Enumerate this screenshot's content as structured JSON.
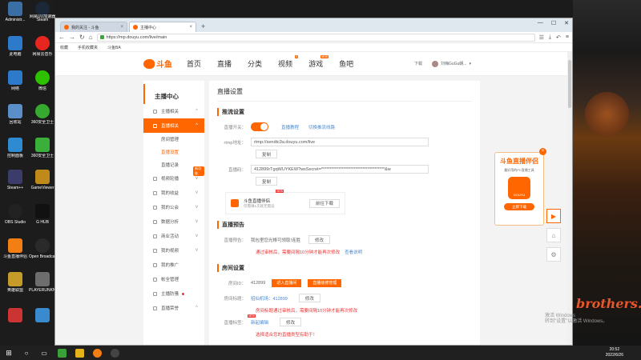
{
  "desktop": {
    "icons": [
      {
        "label": "Administr...",
        "color": "#3a6ea5"
      },
      {
        "label": "Steam",
        "color": "#1b2838"
      },
      {
        "label": "网易UU加速器",
        "color": "#2a7fd4"
      },
      {
        "label": "此电脑",
        "color": "#2c7ac9"
      },
      {
        "label": "网易云音乐",
        "color": "#e6261f"
      },
      {
        "label": "网络",
        "color": "#2c7ac9"
      },
      {
        "label": "微信",
        "color": "#2dc100"
      },
      {
        "label": "回收站",
        "color": "#5b8fc9"
      },
      {
        "label": "360安全卫士",
        "color": "#36a930"
      },
      {
        "label": "控制面板",
        "color": "#2f8bd1"
      },
      {
        "label": "360安全卫士",
        "color": "#3ab03a"
      },
      {
        "label": "Steam++",
        "color": "#3c3c6a"
      },
      {
        "label": "GameViewer",
        "color": "#c08a1a"
      },
      {
        "label": "OBS Studio",
        "color": "#222"
      },
      {
        "label": "G HUB",
        "color": "#111"
      },
      {
        "label": "斗鱼直播伴侣",
        "color": "#f27e14"
      },
      {
        "label": "Open Broadcaster",
        "color": "#2a2a2a"
      },
      {
        "label": "英雄联盟",
        "color": "#c59b2a"
      },
      {
        "label": "PLAYERUNKNOWN'S BATTLEGR...",
        "color": "#6d6d6d"
      },
      {
        "label": "",
        "color": "#c33"
      },
      {
        "label": "",
        "color": "#3a8ad0"
      }
    ]
  },
  "taskbar": {
    "time": "20:52",
    "date": "2022/6/26"
  },
  "browser": {
    "tabs": [
      {
        "label": "我的关注 - 斗鱼"
      },
      {
        "label": "主播中心"
      }
    ],
    "new_tab": "+",
    "url": "https://mp.douyu.com/live/main",
    "bookmarks": [
      "收藏",
      "手机收藏夹",
      "斗鱼BA"
    ]
  },
  "douyu": {
    "logo": "斗鱼",
    "nav": [
      {
        "label": "首页"
      },
      {
        "label": "直播"
      },
      {
        "label": "分类"
      },
      {
        "label": "视频",
        "badge": "5"
      },
      {
        "label": "游戏",
        "badge": "NEW"
      },
      {
        "label": "鱼吧"
      }
    ],
    "download": "下载",
    "username": "刘嗨GuGu朗..."
  },
  "sidebar": {
    "title": "主播中心",
    "items": [
      {
        "label": "主播相关"
      },
      {
        "label": "直播相关",
        "active": true
      },
      {
        "label": "房间管理",
        "sub": true
      },
      {
        "label": "直播设置",
        "sub": true,
        "on": true
      },
      {
        "label": "直播记录",
        "sub": true
      },
      {
        "label": "视频轮播"
      },
      {
        "label": "我的收益"
      },
      {
        "label": "我的公会"
      },
      {
        "label": "数据分析"
      },
      {
        "label": "商业活动"
      },
      {
        "label": "我的视频"
      },
      {
        "label": "我的推广"
      },
      {
        "label": "帐全管理"
      },
      {
        "label": "主播防骚",
        "dot": true
      },
      {
        "label": "直播荣誉"
      }
    ],
    "new_tag": "新功能"
  },
  "content": {
    "title": "直播设置",
    "push_section": "推流设置",
    "live_switch_label": "直播开关：",
    "live_tutorial": "直播教程",
    "backup_line": "切换推流线路",
    "rtmp_label": "rtmp地址：",
    "rtmp_value": "rtmp://sendtc3a.douyu.com/live",
    "copy1": "复制",
    "stream_label": "直播码：",
    "stream_value": "412899rTgqWUYKEW?wsSecret=*************************************&w",
    "copy2": "复制",
    "promo_title": "斗鱼直播伴侣",
    "promo_sub": "仅需填1次就无需设",
    "promo_new": "NEW",
    "promo_btn": "前往下载",
    "preview_section": "直播预告",
    "preview_label": "直播预告：",
    "preview_value": "我包里您光棒可领取!连胜",
    "preview_edit": "修改",
    "preview_warn": "通过审核后，需要间隔10分钟才能再次修改",
    "preview_rule": "查看说明",
    "room_section": "房间设置",
    "room_id_label": "房间ID：",
    "room_id": "412899",
    "enter_room": "进入直播间",
    "room_decor": "直播装修管理",
    "room_name_label": "房间标题：",
    "room_name": "招仙机场：412899",
    "room_name_edit": "修改",
    "room_name_warn": "房间标题通过审核后，需要间隔10分钟才能再次修改",
    "room_tag_label": "直播标签：",
    "room_tag_new": "NEW",
    "room_tag_value": "新起编辑",
    "room_tag_edit": "修改",
    "bottom_hint": "选择适合您的直播类型有助于！"
  },
  "float_widget": {
    "title": "斗鱼直播伴侣",
    "subtitle": "最好用的PC直播工具",
    "app_label": "DOUYU",
    "button": "立即下载",
    "close": "×"
  },
  "activation": {
    "line1": "激活 Windows",
    "line2": "转到\"设置\"以激活 Windows。"
  },
  "wall_text": "brothers."
}
